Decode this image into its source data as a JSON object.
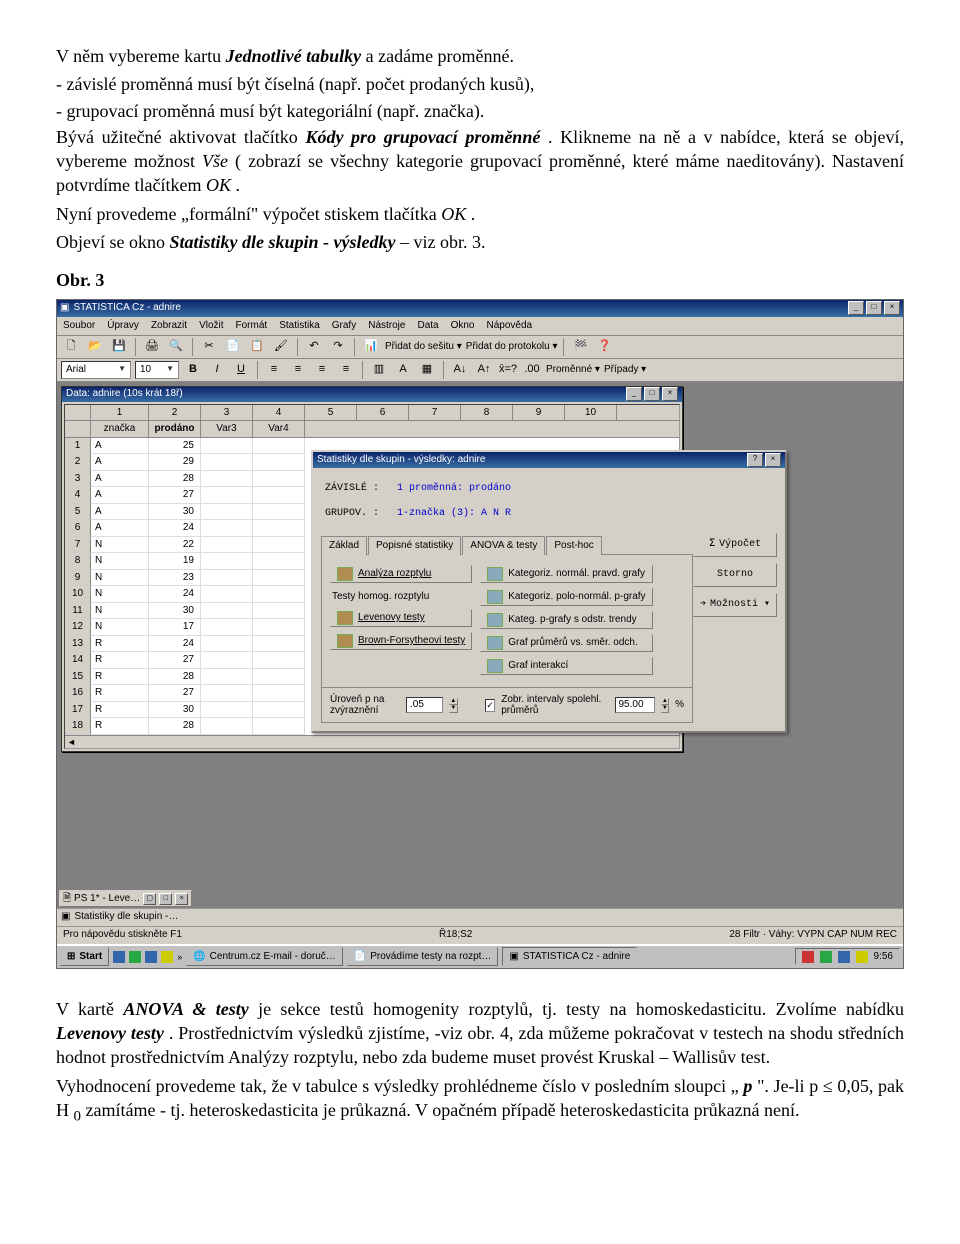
{
  "text": {
    "p1a": "V něm vybereme kartu ",
    "p1b": "Jednotlivé tabulky",
    "p1c": " a zadáme proměnné.",
    "b1a": "-   ",
    "b1b": "závislé proměnná musí být číselná (např. počet prodaných kusů),",
    "b2a": "-   ",
    "b2b": "grupovací proměnná musí být kategoriální (např. značka).",
    "p2a": "Bývá užitečné aktivovat tlačítko ",
    "p2b": "Kódy pro grupovací proměnné",
    "p2c": ". Klikneme na ně a v nabídce, která se objeví, vybereme možnost ",
    "p2d": "Vše",
    "p2e": " ( zobrazí se všechny kategorie grupovací proměnné, které máme naeditovány). Nastavení potvrdíme tlačítkem ",
    "p2f": "OK",
    "p2g": ".",
    "p3a": "Nyní provedeme „formální\" výpočet stiskem tlačítka ",
    "p3b": "OK",
    "p3c": ".",
    "p4a": "Objeví se okno ",
    "p4b": "Statistiky dle skupin - výsledky",
    "p4c": " – viz obr. 3.",
    "fig": "Obr. 3",
    "p5a": "V kartě ",
    "p5b": "ANOVA & testy",
    "p5c": " je sekce testů homogenity rozptylů, tj. testy na homoskedasticitu. Zvolíme nabídku ",
    "p5d": "Levenovy testy",
    "p5e": ". Prostřednictvím výsledků zjistíme, -viz obr. 4, zda můžeme pokračovat v testech na shodu středních hodnot prostřednictvím Analýzy rozptylu, nebo zda budeme muset provést Kruskal – Wallisův test.",
    "p6a": "Vyhodnocení provedeme tak, že v tabulce s výsledky prohlédneme číslo v posledním sloupci „",
    "p6b": "p",
    "p6c": "\". Je-li p ≤ 0,05, pak H",
    "p6d": "0",
    "p6e": " zamítáme - tj. heteroskedasticita je průkazná. V opačném případě heteroskedasticita průkazná není."
  },
  "app": {
    "title": "STATISTICA Cz - adnire",
    "menus": [
      "Soubor",
      "Úpravy",
      "Zobrazit",
      "Vložit",
      "Formát",
      "Statistika",
      "Grafy",
      "Nástroje",
      "Data",
      "Okno",
      "Nápověda"
    ],
    "font_name": "Arial",
    "font_size": "10",
    "toolbar_texts": {
      "add_sheet": "Přidat do sešitu ▾",
      "add_proto": "Přidat do protokolu ▾",
      "vars": "Proměnné ▾",
      "cases": "Případy ▾"
    },
    "data_win_title": "Data: adnire (10s krát 18ř)",
    "columns_nums": [
      "1",
      "2",
      "3",
      "4",
      "5",
      "6",
      "7",
      "8",
      "9",
      "10"
    ],
    "columns_names": [
      "značka",
      "prodáno",
      "Var3",
      "Var4"
    ],
    "rows": [
      {
        "n": "1",
        "z": "A",
        "p": "25"
      },
      {
        "n": "2",
        "z": "A",
        "p": "29"
      },
      {
        "n": "3",
        "z": "A",
        "p": "28"
      },
      {
        "n": "4",
        "z": "A",
        "p": "27"
      },
      {
        "n": "5",
        "z": "A",
        "p": "30"
      },
      {
        "n": "6",
        "z": "A",
        "p": "24"
      },
      {
        "n": "7",
        "z": "N",
        "p": "22"
      },
      {
        "n": "8",
        "z": "N",
        "p": "19"
      },
      {
        "n": "9",
        "z": "N",
        "p": "23"
      },
      {
        "n": "10",
        "z": "N",
        "p": "24"
      },
      {
        "n": "11",
        "z": "N",
        "p": "30"
      },
      {
        "n": "12",
        "z": "N",
        "p": "17"
      },
      {
        "n": "13",
        "z": "R",
        "p": "24"
      },
      {
        "n": "14",
        "z": "R",
        "p": "27"
      },
      {
        "n": "15",
        "z": "R",
        "p": "28"
      },
      {
        "n": "16",
        "z": "R",
        "p": "27"
      },
      {
        "n": "17",
        "z": "R",
        "p": "30"
      },
      {
        "n": "18",
        "z": "R",
        "p": "28"
      }
    ],
    "dlg": {
      "title": "Statistiky dle skupin - výsledky: adnire",
      "zavisle_label": "ZÁVISLÉ :",
      "zavisle_val": "1 proměnná: prodáno",
      "grupov_label": "GRUPOV. :",
      "grupov_val": "1-značka  (3): A N R",
      "tabs": [
        "Základ",
        "Popisné statistiky",
        "ANOVA & testy",
        "Post-hoc"
      ],
      "left_buttons": [
        "Analýza rozptylu",
        "Testy homog. rozptylu",
        "Levenovy testy",
        "Brown-Forsytheovi testy"
      ],
      "mid_buttons": [
        "Kategoriz. normál. pravd. grafy",
        "Kategoriz. polo-normál. p-grafy",
        "Kateg. p-grafy s odstr. trendy",
        "Graf průměrů vs. směr. odch.",
        "Graf interakcí"
      ],
      "right_buttons": [
        "Výpočet",
        "Storno",
        "Možnosti ▾"
      ],
      "level_label": "Úroveň p na zvýraznění",
      "level_value": ".05",
      "chk_label": "Zobr. intervaly spolehl. průměrů",
      "ci_value": "95.00",
      "pct": "%"
    },
    "min_win": "PS 1* - Leve…",
    "sec_bar": "Statistiky dle skupin -…",
    "status_left": "Pro nápovědu stiskněte F1",
    "status_mid": "Ř18;S2",
    "status_right": "28   Filtr · Váhy: VYPN   CAP   NUM   REC",
    "taskbar": {
      "start": "Start",
      "tasks": [
        "Centrum.cz E-mail - doruč…",
        "Provádíme testy na rozpt…",
        "STATISTICA Cz - adnire"
      ],
      "clock": "9:56"
    }
  }
}
